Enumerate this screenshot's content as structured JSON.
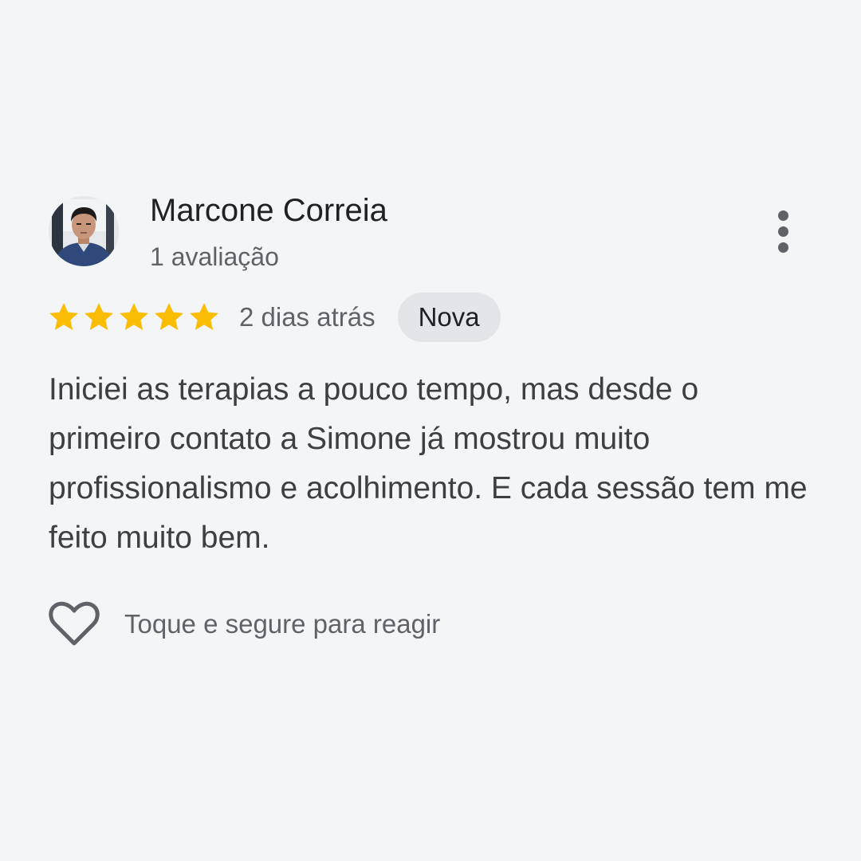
{
  "review": {
    "reviewer_name": "Marcone Correia",
    "review_count": "1 avaliação",
    "rating": 5,
    "rating_max": 5,
    "date": "2 dias atrás",
    "badge": "Nova",
    "text": "Iniciei as terapias a pouco tempo, mas desde o primeiro contato a Simone já mostrou muito profissionalismo e acolhimento. E cada sessão tem me feito muito bem.",
    "react_hint": "Toque e segure para reagir"
  },
  "icons": {
    "avatar": "avatar-photo",
    "more": "more-vert-icon",
    "star": "star-icon",
    "heart": "heart-outline-icon"
  },
  "colors": {
    "background": "#f4f5f7",
    "star": "#fbbc04",
    "badge_bg": "#e4e5e8",
    "primary_text": "#202124",
    "secondary_text": "#5f6368",
    "body_text": "#3c4043"
  }
}
